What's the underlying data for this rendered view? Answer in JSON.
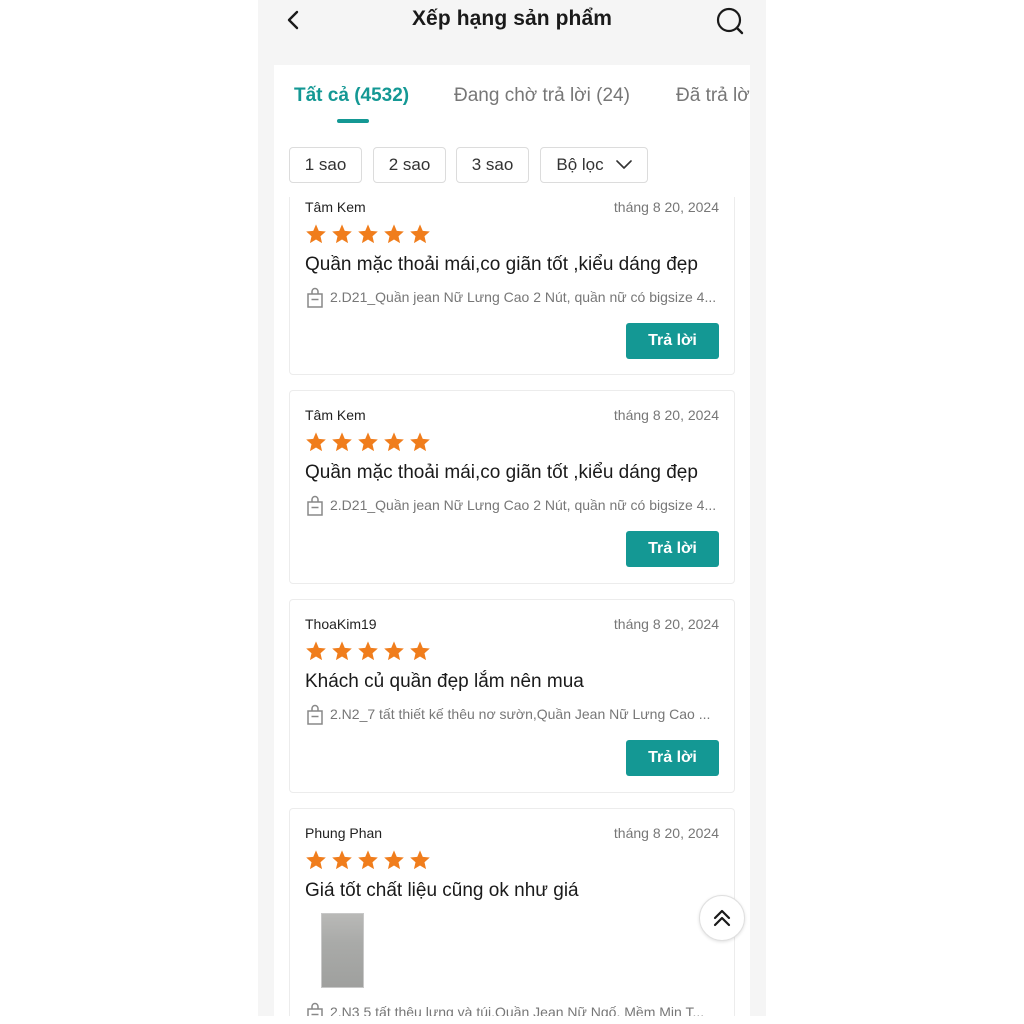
{
  "header": {
    "title": "Xếp hạng sản phẩm"
  },
  "tabs": [
    {
      "label": "Tất cả (4532)",
      "active": true
    },
    {
      "label": "Đang chờ trả lời (24)",
      "active": false
    },
    {
      "label": "Đã trả lời",
      "active": false
    }
  ],
  "filters": [
    {
      "label": "1 sao"
    },
    {
      "label": "2 sao"
    },
    {
      "label": "3 sao"
    },
    {
      "label": "Bộ lọc",
      "icon": "chevron-down-icon"
    }
  ],
  "reviews": [
    {
      "reviewer": "Tâm Kem",
      "date": "tháng 8 20, 2024",
      "rating": 5,
      "comment": "Quần mặc thoải mái,co giãn tốt ,kiểu dáng đẹp",
      "product": "2.D21_Quần jean Nữ Lưng Cao 2 Nút, quần nữ có bigsize 4...",
      "reply_label": "Trả lời"
    },
    {
      "reviewer": "Tâm Kem",
      "date": "tháng 8 20, 2024",
      "rating": 5,
      "comment": "Quần mặc thoải mái,co giãn tốt ,kiểu dáng đẹp",
      "product": "2.D21_Quần jean Nữ Lưng Cao 2 Nút, quần nữ có bigsize 4...",
      "reply_label": "Trả lời"
    },
    {
      "reviewer": "ThoaKim19",
      "date": "tháng 8 20, 2024",
      "rating": 5,
      "comment": "Khách củ quần đẹp lắm nên mua",
      "product": "2.N2_7 tất thiết kế thêu nơ sườn,Quần Jean Nữ Lưng Cao ...",
      "reply_label": "Trả lời"
    },
    {
      "reviewer": "Phung Phan",
      "date": "tháng 8 20, 2024",
      "rating": 5,
      "comment": "Giá tốt chất liệu cũng ok như giá",
      "product": "2.N3 5 tất thêu lưng và túi,Quần Jean Nữ Ngố, Mềm Mịn T...",
      "has_photo": true
    }
  ],
  "colors": {
    "accent": "#149894",
    "star": "#f07d1c",
    "background": "#f5f5f5"
  },
  "icons": {
    "back": "back-icon",
    "search": "search-icon",
    "bag": "shopping-bag-icon",
    "scroll_top": "double-chevron-up-icon",
    "star": "star-icon"
  }
}
